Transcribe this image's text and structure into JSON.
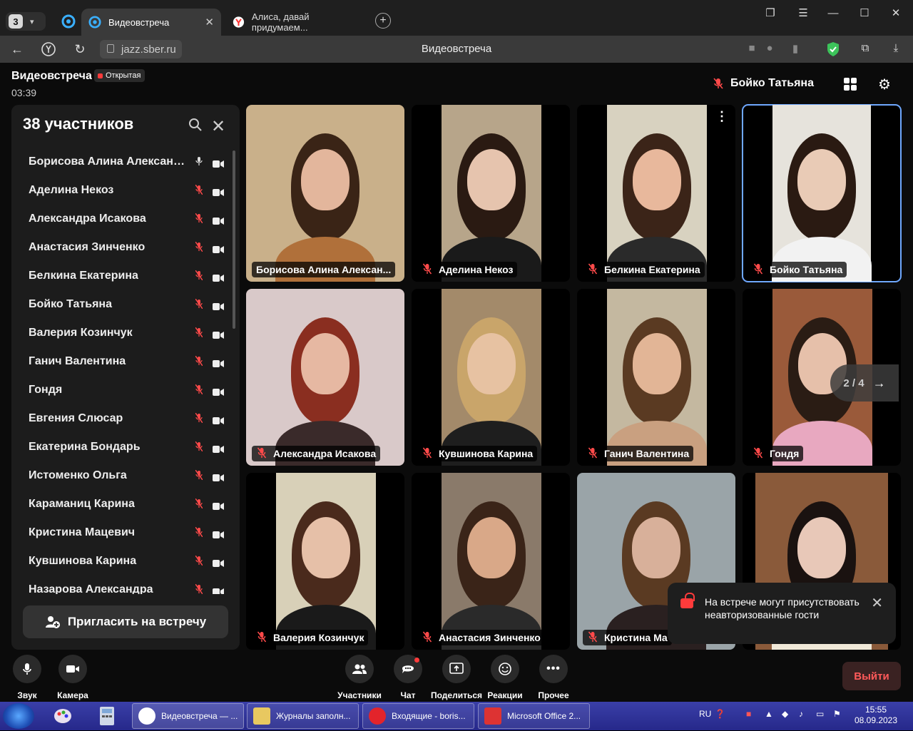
{
  "browser": {
    "tab_count": "3",
    "tabs": [
      {
        "label": "Видеовстреча",
        "active": true
      },
      {
        "label": "Алиса, давай придумаем...",
        "active": false
      }
    ],
    "url": "jazz.sber.ru",
    "page_title": "Видеовстреча"
  },
  "meeting": {
    "title": "Видеовстреча",
    "badge": "Открытая",
    "timer": "03:39",
    "current_speaker": "Бойко Татьяна"
  },
  "panel": {
    "title": "38 участников",
    "participants": [
      {
        "name": "Борисова Алина Александ...",
        "mic_on": true
      },
      {
        "name": "Аделина Некоз",
        "mic_on": false
      },
      {
        "name": "Александра Исакова",
        "mic_on": false
      },
      {
        "name": "Анастасия Зинченко",
        "mic_on": false
      },
      {
        "name": "Белкина Екатерина",
        "mic_on": false
      },
      {
        "name": "Бойко Татьяна",
        "mic_on": false
      },
      {
        "name": "Валерия Козинчук",
        "mic_on": false
      },
      {
        "name": "Ганич Валентина",
        "mic_on": false
      },
      {
        "name": "Гондя",
        "mic_on": false
      },
      {
        "name": "Евгения Слюсар",
        "mic_on": false
      },
      {
        "name": "Екатерина Бондарь",
        "mic_on": false
      },
      {
        "name": "Истоменко Ольга",
        "mic_on": false
      },
      {
        "name": "Караманиц Карина",
        "mic_on": false
      },
      {
        "name": "Кристина Мацевич",
        "mic_on": false
      },
      {
        "name": "Кувшинова Карина",
        "mic_on": false
      },
      {
        "name": "Назарова Александра",
        "mic_on": false
      }
    ],
    "invite_label": "Пригласить на встречу"
  },
  "tiles": [
    {
      "name": "Борисова Алина Алексан...",
      "muted": false
    },
    {
      "name": "Аделина Некоз",
      "muted": true
    },
    {
      "name": "Белкина Екатерина",
      "muted": true
    },
    {
      "name": "Бойко Татьяна",
      "muted": true
    },
    {
      "name": "Александра Исакова",
      "muted": true
    },
    {
      "name": "Кувшинова Карина",
      "muted": true
    },
    {
      "name": "Ганич Валентина",
      "muted": true
    },
    {
      "name": "Гондя",
      "muted": true
    },
    {
      "name": "Валерия Козинчук",
      "muted": true
    },
    {
      "name": "Анастасия Зинченко",
      "muted": true
    },
    {
      "name": "Кристина Ма",
      "muted": true
    },
    {
      "name": "",
      "muted": false
    }
  ],
  "pager": {
    "label": "2 / 4"
  },
  "toast": {
    "text": "На встрече могут присутствовать неавторизованные гости"
  },
  "controls": {
    "sound": "Звук",
    "camera": "Камера",
    "participants": "Участники",
    "chat": "Чат",
    "share": "Поделиться",
    "reactions": "Реакции",
    "more": "Прочее",
    "leave": "Выйти"
  },
  "taskbar": {
    "buttons": [
      {
        "label": "Видеовстреча — ..."
      },
      {
        "label": "Журналы заполн..."
      },
      {
        "label": "Входящие - boris..."
      },
      {
        "label": "Microsoft Office 2..."
      }
    ],
    "lang": "RU",
    "time": "15:55",
    "date": "08.09.2023"
  },
  "colors": {
    "accent_red": "#ff4a4a",
    "selected_outline": "#6fa8ff",
    "leave_text": "#ff5a5a"
  }
}
